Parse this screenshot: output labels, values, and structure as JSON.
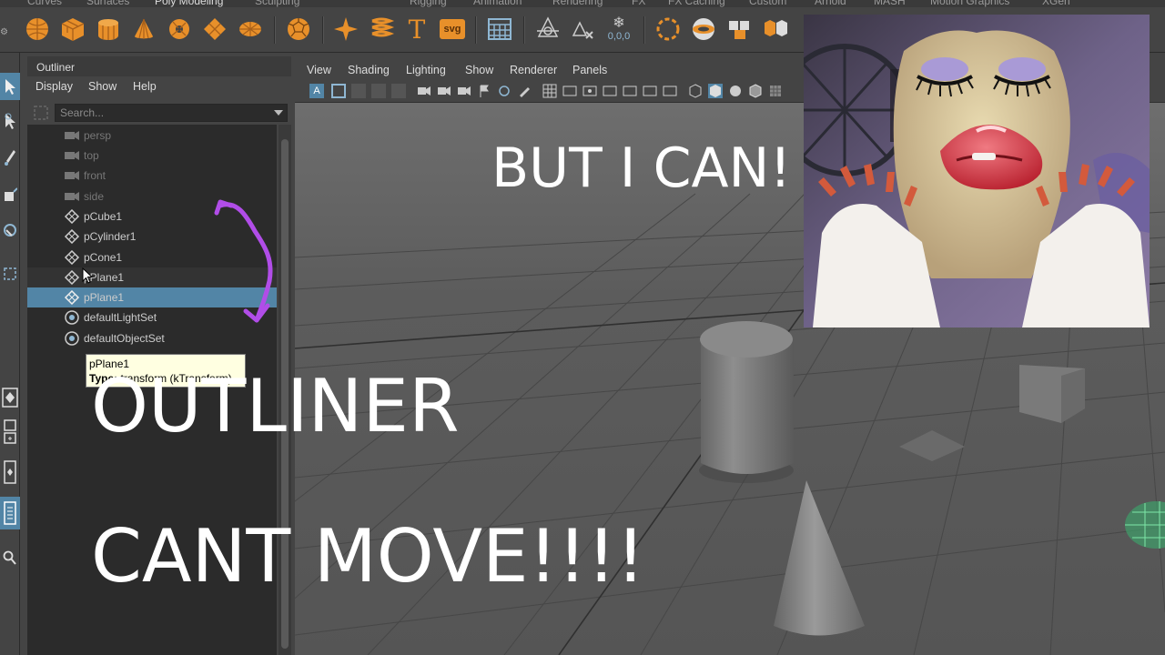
{
  "shelf": {
    "tabs": [
      "Curves",
      "Surfaces",
      "Poly Modeling",
      "Sculpting",
      "Rigging",
      "Animation",
      "Rendering",
      "FX",
      "FX Caching",
      "Custom",
      "Arnold",
      "MASH",
      "Motion Graphics",
      "XGen"
    ],
    "active_tab": "Poly Modeling",
    "icons": [
      "sphere-icon",
      "cube-icon",
      "cylinder-icon",
      "cone-icon",
      "torus-icon",
      "plane-icon",
      "disc-icon",
      "soccer-icon",
      "star-icon",
      "helix-icon",
      "text-icon",
      "svg-icon",
      "grid-icon",
      "center-pivot-icon",
      "freeze-icon",
      "snowflake-icon",
      "sphere-select-icon",
      "platonic-icon",
      "combine-icon",
      "separate-icon"
    ],
    "text_label": "T",
    "svg_label": "svg",
    "freeze_label": "0,0,0"
  },
  "outliner": {
    "title": "Outliner",
    "menu": [
      "Display",
      "Show",
      "Help"
    ],
    "search_placeholder": "Search...",
    "items": [
      {
        "label": "persp",
        "type": "camera"
      },
      {
        "label": "top",
        "type": "camera"
      },
      {
        "label": "front",
        "type": "camera"
      },
      {
        "label": "side",
        "type": "camera"
      },
      {
        "label": "pCube1",
        "type": "mesh"
      },
      {
        "label": "pCylinder1",
        "type": "mesh"
      },
      {
        "label": "pCone1",
        "type": "mesh"
      },
      {
        "label": "pPlane1",
        "type": "mesh"
      },
      {
        "label": "pPlane1",
        "type": "mesh"
      },
      {
        "label": "defaultLightSet",
        "type": "set"
      },
      {
        "label": "defaultObjectSet",
        "type": "set"
      }
    ],
    "tooltip": {
      "name": "pPlane1",
      "type_label": "Type:",
      "type_value": "transform (kTransform)"
    }
  },
  "viewport": {
    "menu": [
      "View",
      "Shading",
      "Lighting",
      "Show",
      "Renderer",
      "Panels"
    ]
  },
  "overlay": {
    "line1": "OUTLINER",
    "line2": "CANT MOVE!!!!",
    "reply": "BUT I CAN!"
  },
  "colors": {
    "accent": "#5285a6",
    "icon_orange": "#e8902a",
    "annotation": "#b14de8"
  }
}
